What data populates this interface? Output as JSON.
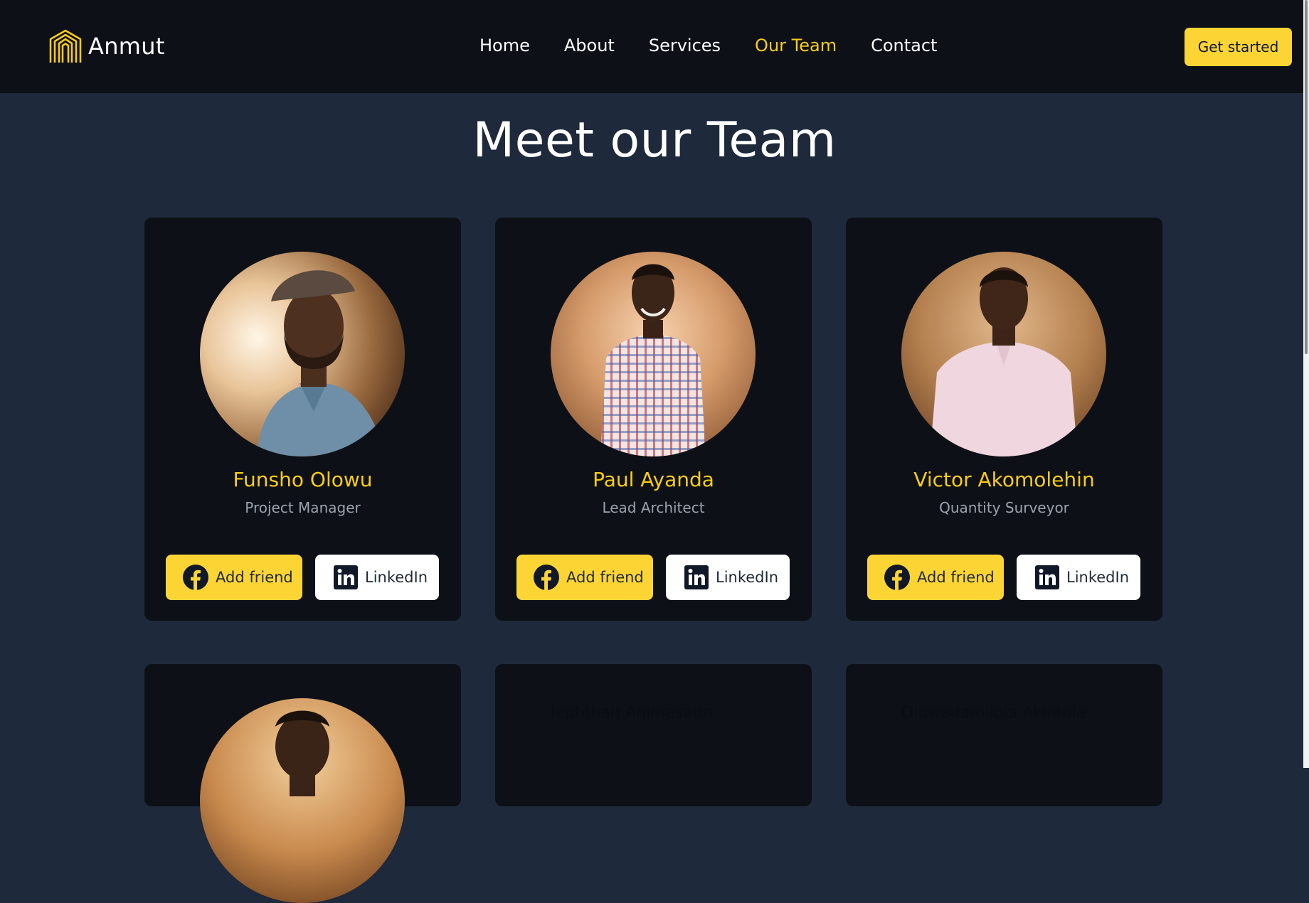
{
  "brand": {
    "name": "Anmut",
    "accent": "#facc15"
  },
  "nav": {
    "items": [
      {
        "label": "Home"
      },
      {
        "label": "About"
      },
      {
        "label": "Services"
      },
      {
        "label": "Our Team"
      },
      {
        "label": "Contact"
      }
    ],
    "active": "Our Team",
    "cta_label": "Get started"
  },
  "page": {
    "title": "Meet our Team"
  },
  "team": [
    {
      "name": "Funsho Olowu",
      "role": "Project Manager",
      "facebook_label": "Add friend",
      "linkedin_label": "LinkedIn"
    },
    {
      "name": "Paul Ayanda",
      "role": "Lead Architect",
      "facebook_label": "Add friend",
      "linkedin_label": "LinkedIn"
    },
    {
      "name": "Victor Akomolehin",
      "role": "Quantity Surveyor",
      "facebook_label": "Add friend",
      "linkedin_label": "LinkedIn"
    },
    {
      "name": "",
      "role": ""
    },
    {
      "name": "Jephthah Animasaun",
      "role": ""
    },
    {
      "name": "Oluwadamilola Akintola",
      "role": ""
    }
  ],
  "icons": {
    "logo": "arch-logo-icon",
    "facebook": "facebook-icon",
    "linkedin": "linkedin-icon"
  },
  "colors": {
    "header_bg": "#0d1117",
    "page_bg": "#1e293b",
    "card_bg": "#0d1117",
    "button_yellow": "#fcd535"
  }
}
